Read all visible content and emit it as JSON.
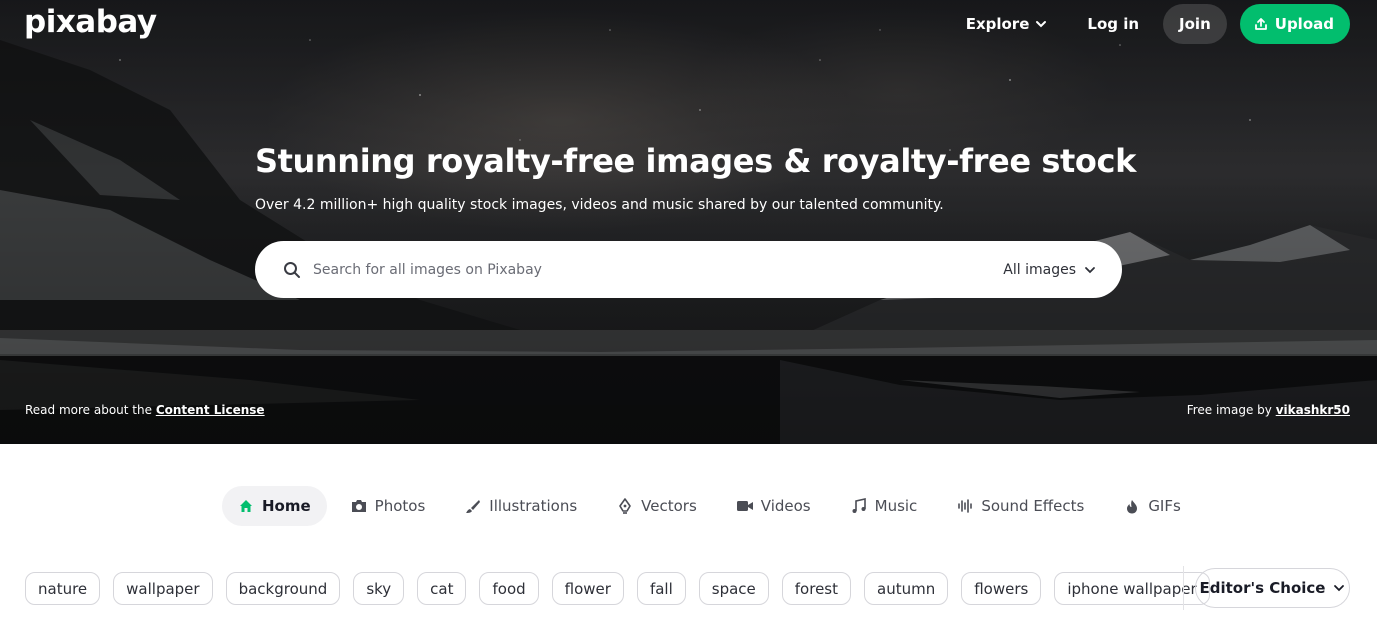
{
  "brand": {
    "logo_text": "pixabay"
  },
  "nav": {
    "explore_label": "Explore",
    "login_label": "Log in",
    "join_label": "Join",
    "upload_label": "Upload"
  },
  "hero": {
    "headline": "Stunning royalty-free images & royalty-free stock",
    "subline": "Over 4.2 million+ high quality stock images, videos and music shared by our talented community.",
    "search": {
      "placeholder": "Search for all images on Pixabay",
      "value": "",
      "type_selected": "All images"
    },
    "license_prefix": "Read more about the ",
    "license_link": "Content License",
    "credit_prefix": "Free image by ",
    "credit_author": "vikashkr50"
  },
  "tabs": [
    {
      "label": "Home",
      "icon": "home-icon",
      "active": true
    },
    {
      "label": "Photos",
      "icon": "camera-icon",
      "active": false
    },
    {
      "label": "Illustrations",
      "icon": "brush-icon",
      "active": false
    },
    {
      "label": "Vectors",
      "icon": "pen-nib-icon",
      "active": false
    },
    {
      "label": "Videos",
      "icon": "video-camera-icon",
      "active": false
    },
    {
      "label": "Music",
      "icon": "music-note-icon",
      "active": false
    },
    {
      "label": "Sound Effects",
      "icon": "waveform-icon",
      "active": false
    },
    {
      "label": "GIFs",
      "icon": "flame-icon",
      "active": false
    }
  ],
  "tags": [
    "nature",
    "wallpaper",
    "background",
    "sky",
    "cat",
    "food",
    "flower",
    "fall",
    "space",
    "forest",
    "autumn",
    "flowers",
    "iphone wallpaper"
  ],
  "filter": {
    "label": "Editor's Choice"
  },
  "colors": {
    "accent": "#02be6e",
    "text": "#191b26",
    "chip_border": "#d6d6db",
    "active_tab_bg": "#f2f2f4"
  }
}
